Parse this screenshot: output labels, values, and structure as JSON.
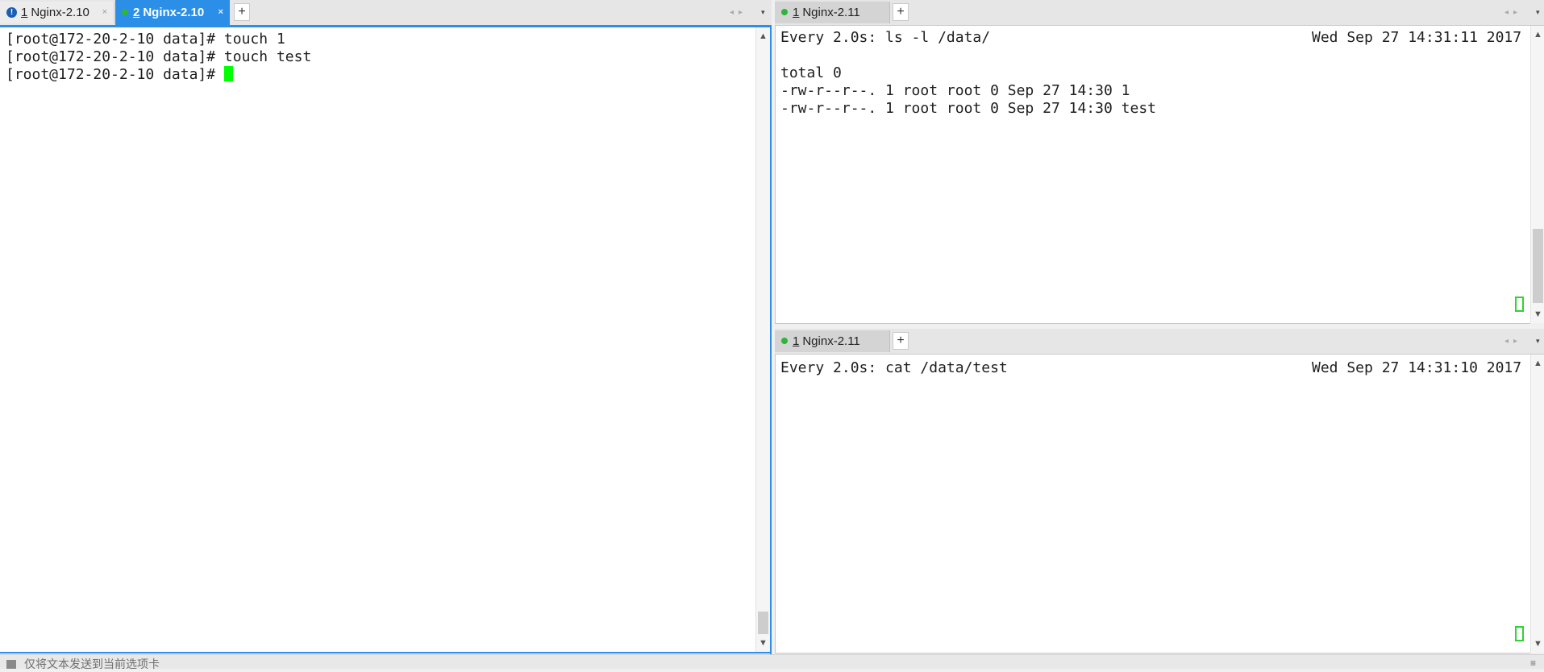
{
  "left_pane": {
    "tabs": [
      {
        "num": "1",
        "label": "Nginx-2.10",
        "close": "×",
        "status_icon": "warning-icon",
        "icon_glyph": "!"
      },
      {
        "num": "2",
        "label": "Nginx-2.10",
        "close": "×",
        "status_icon": "connected-dot-icon"
      }
    ],
    "new_tab": "+",
    "nav_arrows": "◂▸",
    "dropdown": "▾",
    "lines": [
      "[root@172-20-2-10 data]# touch 1",
      "[root@172-20-2-10 data]# touch test",
      "[root@172-20-2-10 data]# "
    ]
  },
  "right_top_pane": {
    "tab": {
      "num": "1",
      "label": "Nginx-2.11",
      "close": "",
      "status_icon": "connected-dot-icon"
    },
    "new_tab": "+",
    "nav_arrows": "◂▸",
    "dropdown": "▾",
    "header_command": "Every 2.0s: ls -l /data/",
    "header_datetime": "Wed Sep 27 14:31:11 2017",
    "lines": [
      "",
      "total 0",
      "-rw-r--r--. 1 root root 0 Sep 27 14:30 1",
      "-rw-r--r--. 1 root root 0 Sep 27 14:30 test"
    ]
  },
  "right_bottom_pane": {
    "tab": {
      "num": "1",
      "label": "Nginx-2.11",
      "close": "",
      "status_icon": "connected-dot-icon"
    },
    "new_tab": "+",
    "nav_arrows": "◂▸",
    "dropdown": "▾",
    "header_command": "Every 2.0s: cat /data/test",
    "header_datetime": "Wed Sep 27 14:31:10 2017"
  },
  "status_bar": {
    "text": "仅将文本发送到当前选项卡",
    "right_glyph": "≡"
  },
  "scroll": {
    "up": "▲",
    "down": "▼"
  },
  "colors": {
    "active_tab": "#2b8fe8",
    "cursor": "#00ff00",
    "connected": "#2fb43c",
    "warning": "#1a5fb4"
  }
}
